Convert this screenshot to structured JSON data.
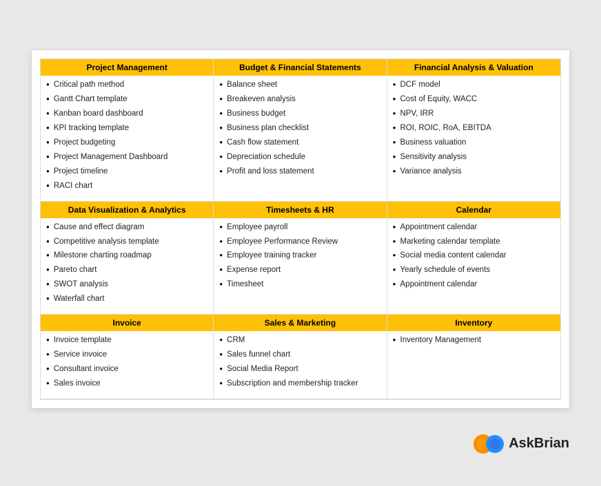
{
  "sections": [
    {
      "id": "project-management",
      "header": "Project Management",
      "items": [
        "Critical path method",
        "Gantt Chart template",
        "Kanban board dashboard",
        "KPI tracking template",
        "Project budgeting",
        "Project Management Dashboard",
        "Project timeline",
        "RACI chart"
      ]
    },
    {
      "id": "budget-financial",
      "header": "Budget & Financial Statements",
      "items": [
        "Balance sheet",
        "Breakeven analysis",
        "Business budget",
        "Business plan checklist",
        "Cash flow statement",
        "Depreciation schedule",
        "Profit and loss statement"
      ]
    },
    {
      "id": "financial-analysis",
      "header": "Financial Analysis & Valuation",
      "items": [
        "DCF model",
        "Cost of Equity, WACC",
        "NPV, IRR",
        "ROI, ROIC, RoA, EBITDA",
        "Business valuation",
        "Sensitivity analysis",
        "Variance analysis"
      ]
    },
    {
      "id": "data-visualization",
      "header": "Data Visualization & Analytics",
      "items": [
        "Cause and effect diagram",
        "Competitive analysis template",
        "Milestone charting roadmap",
        "Pareto chart",
        "SWOT analysis",
        "Waterfall chart"
      ]
    },
    {
      "id": "timesheets-hr",
      "header": "Timesheets & HR",
      "items": [
        "Employee payroll",
        "Employee Performance Review",
        "Employee training tracker",
        "Expense report",
        "Timesheet"
      ]
    },
    {
      "id": "calendar",
      "header": "Calendar",
      "items": [
        "Appointment calendar",
        "Marketing calendar template",
        "Social media content calendar",
        "Yearly schedule of events",
        "Appointment calendar"
      ]
    },
    {
      "id": "invoice",
      "header": "Invoice",
      "items": [
        "Invoice template",
        "Service invoice",
        "Consultant invoice",
        "Sales invoice"
      ]
    },
    {
      "id": "sales-marketing",
      "header": "Sales & Marketing",
      "items": [
        "CRM",
        "Sales funnel chart",
        "Social Media Report",
        "Subscription and membership tracker"
      ]
    },
    {
      "id": "inventory",
      "header": "Inventory",
      "items": [
        "Inventory Management"
      ]
    }
  ],
  "branding": {
    "text": "AskBrian"
  }
}
